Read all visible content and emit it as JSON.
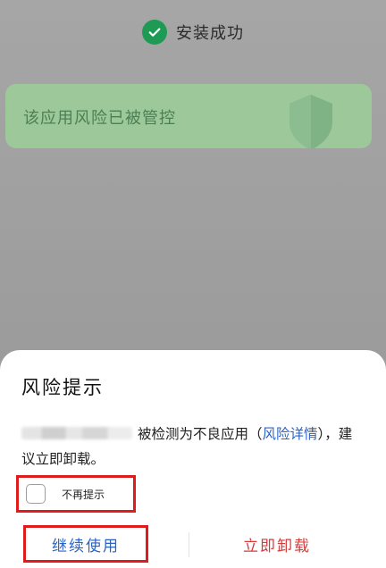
{
  "install": {
    "status_text": "安装成功"
  },
  "protect_card": {
    "text": "该应用风险已被管控"
  },
  "dialog": {
    "title": "风险提示",
    "message_part1": "被检测为不良应用（",
    "risk_details_link": "风险详情",
    "message_part2": "），建议立即卸载。",
    "no_remind_label": "不再提示",
    "continue_button": "继续使用",
    "uninstall_button": "立即卸载"
  },
  "colors": {
    "accent_blue": "#2a62c8",
    "danger_red": "#d63b3b",
    "success_green": "#1f9a54",
    "highlight_box": "#e01b1b"
  }
}
